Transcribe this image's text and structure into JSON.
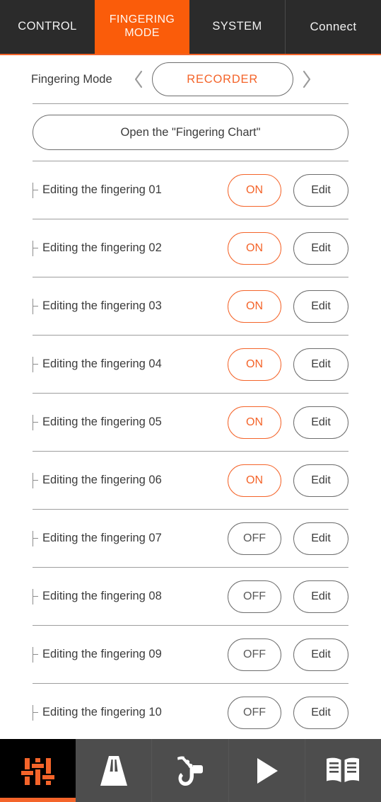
{
  "header": {
    "tabs": [
      {
        "label": "CONTROL",
        "active": false
      },
      {
        "label": "FINGERING MODE",
        "line1": "FINGERING",
        "line2": "MODE",
        "active": true
      },
      {
        "label": "SYSTEM",
        "active": false
      },
      {
        "label": "Connect",
        "active": false
      }
    ],
    "accent_color": "#f4642a",
    "background_color": "#2b2b2b"
  },
  "mode_selector": {
    "label": "Fingering Mode",
    "prev_icon": "chevron-left-icon",
    "next_icon": "chevron-right-icon",
    "value": "RECORDER",
    "value_color": "#f4642a"
  },
  "chart_button": {
    "label": "Open the \"Fingering Chart\""
  },
  "list": {
    "state_on": "ON",
    "state_off": "OFF",
    "edit_label": "Edit",
    "rows": [
      {
        "label": "Editing the fingering 01",
        "state": "ON",
        "edit": "Edit"
      },
      {
        "label": "Editing the fingering 02",
        "state": "ON",
        "edit": "Edit"
      },
      {
        "label": "Editing the fingering 03",
        "state": "ON",
        "edit": "Edit"
      },
      {
        "label": "Editing the fingering 04",
        "state": "ON",
        "edit": "Edit"
      },
      {
        "label": "Editing the fingering 05",
        "state": "ON",
        "edit": "Edit"
      },
      {
        "label": "Editing the fingering 06",
        "state": "ON",
        "edit": "Edit"
      },
      {
        "label": "Editing the fingering 07",
        "state": "OFF",
        "edit": "Edit"
      },
      {
        "label": "Editing the fingering 08",
        "state": "OFF",
        "edit": "Edit"
      },
      {
        "label": "Editing the fingering 09",
        "state": "OFF",
        "edit": "Edit"
      },
      {
        "label": "Editing the fingering 10",
        "state": "OFF",
        "edit": "Edit"
      }
    ]
  },
  "bottom_nav": {
    "items": [
      {
        "icon": "sliders-icon",
        "active": true
      },
      {
        "icon": "metronome-icon",
        "active": false
      },
      {
        "icon": "saxophone-icon",
        "active": false
      },
      {
        "icon": "play-icon",
        "active": false
      },
      {
        "icon": "book-icon",
        "active": false
      }
    ],
    "active_color": "#f4642a",
    "icon_color": "#ffffff",
    "background_color": "#4d4d4d"
  }
}
